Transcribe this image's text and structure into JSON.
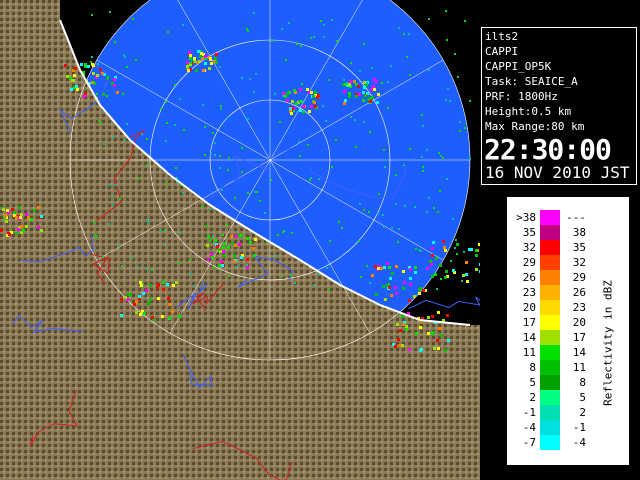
{
  "window": {
    "title": ""
  },
  "info": {
    "site": "ilts2",
    "product": "CAPPI",
    "product_name": "CAPPI_OP5K",
    "task": "Task: SEAICE_A",
    "prf": "PRF: 1800Hz",
    "height": "Height:0.5 km",
    "max_range": "Max Range:80 km",
    "time": "22:30:00",
    "date": "16 NOV 2010 JST"
  },
  "legend": {
    "unit_label": "Reflectivity in dBZ",
    "rows": [
      {
        "lo": ">38",
        "hi": "---",
        "color": "#ff00ff"
      },
      {
        "lo": "35",
        "hi": "38",
        "color": "#c00080"
      },
      {
        "lo": "32",
        "hi": "35",
        "color": "#ff0000"
      },
      {
        "lo": "29",
        "hi": "32",
        "color": "#ff4000"
      },
      {
        "lo": "26",
        "hi": "29",
        "color": "#ff8000"
      },
      {
        "lo": "23",
        "hi": "26",
        "color": "#ffb000"
      },
      {
        "lo": "20",
        "hi": "23",
        "color": "#ffd800"
      },
      {
        "lo": "17",
        "hi": "20",
        "color": "#ffff00"
      },
      {
        "lo": "14",
        "hi": "17",
        "color": "#a0e000"
      },
      {
        "lo": "11",
        "hi": "14",
        "color": "#00e000"
      },
      {
        "lo": "8",
        "hi": "11",
        "color": "#00c000"
      },
      {
        "lo": "5",
        "hi": "8",
        "color": "#00a000"
      },
      {
        "lo": "2",
        "hi": "5",
        "color": "#00ff80"
      },
      {
        "lo": "-1",
        "hi": "2",
        "color": "#00e0b0"
      },
      {
        "lo": "-4",
        "hi": "-1",
        "color": "#00e0e0"
      },
      {
        "lo": "-7",
        "hi": "-4",
        "color": "#00ffff"
      }
    ]
  },
  "map": {
    "sea_color": "#1e5eff",
    "land_color": "#7a6a45",
    "outside_color": "#000000",
    "coast_color": "#ffffff",
    "river_color": "#4060ff",
    "border_color": "#d02020"
  }
}
